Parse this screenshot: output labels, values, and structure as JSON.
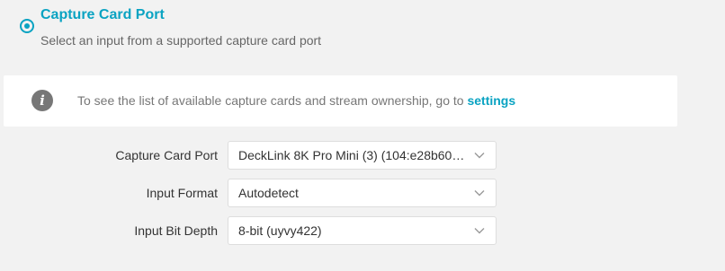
{
  "option": {
    "title": "Capture Card Port",
    "description": "Select an input from a supported capture card port",
    "selected": true
  },
  "info": {
    "icon": "info-icon",
    "glyph": "i",
    "text": "To see the list of available capture cards and stream ownership, go to ",
    "link_label": "settings"
  },
  "form": {
    "rows": [
      {
        "label": "Capture Card Port",
        "value": "DeckLink 8K Pro Mini (3) (104:e28b606…"
      },
      {
        "label": "Input Format",
        "value": "Autodetect"
      },
      {
        "label": "Input Bit Depth",
        "value": "8-bit (uyvy422)"
      }
    ]
  },
  "colors": {
    "accent": "#0aa3c2",
    "background": "#f2f2f2",
    "panel": "#ffffff"
  }
}
